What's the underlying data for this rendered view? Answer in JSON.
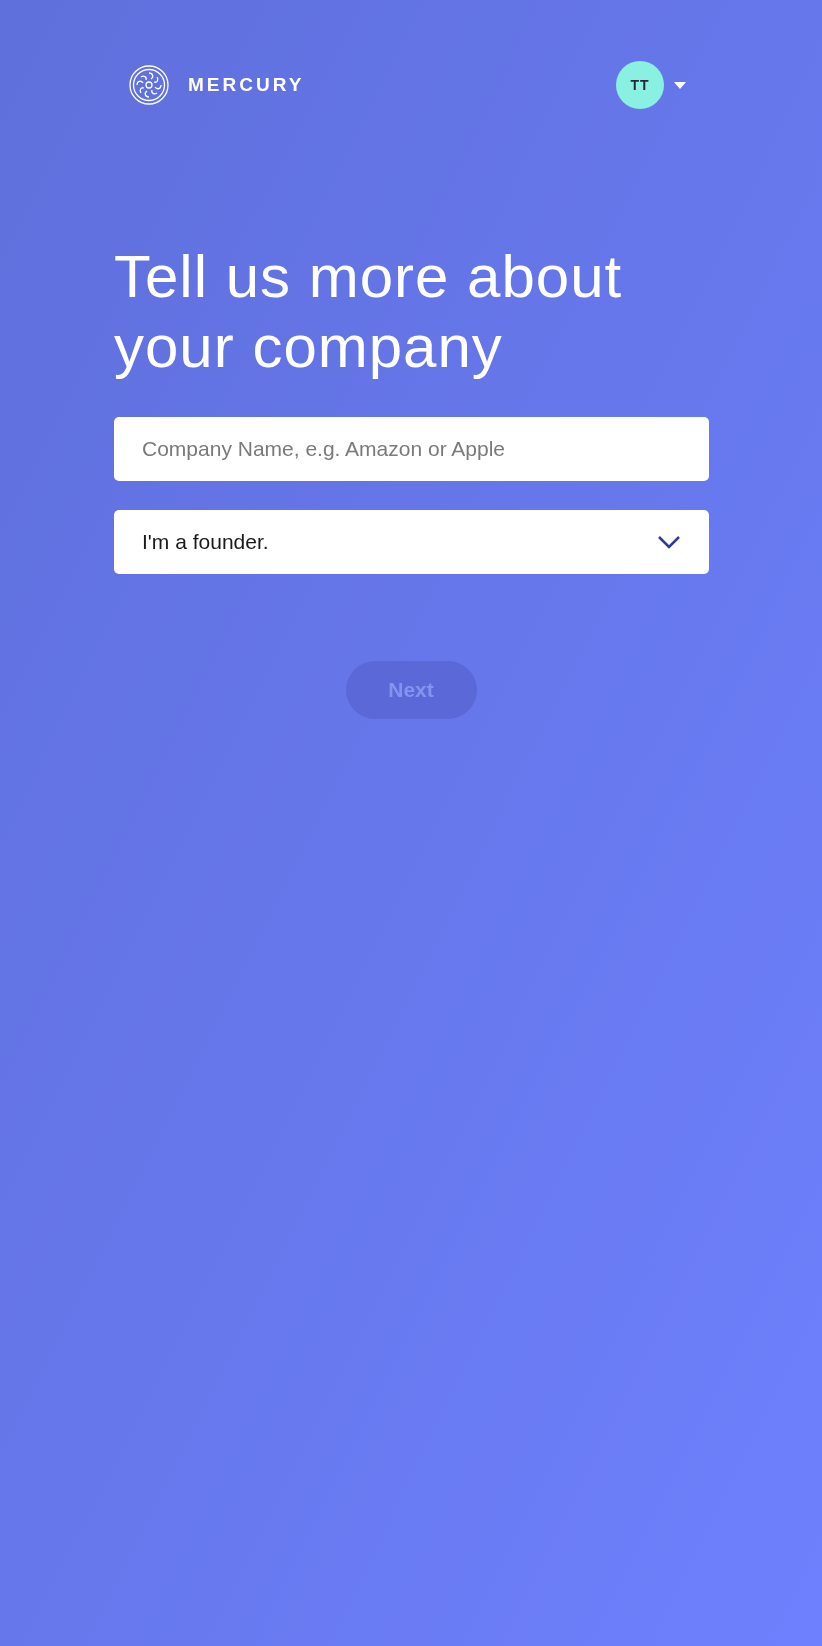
{
  "header": {
    "brand": "MERCURY",
    "avatar_initials": "TT"
  },
  "title": "Tell us more about your company",
  "company_field": {
    "placeholder": "Company Name, e.g. Amazon or Apple"
  },
  "role_select": {
    "value": "I'm a founder."
  },
  "next_button": {
    "label": "Next",
    "disabled": true
  }
}
